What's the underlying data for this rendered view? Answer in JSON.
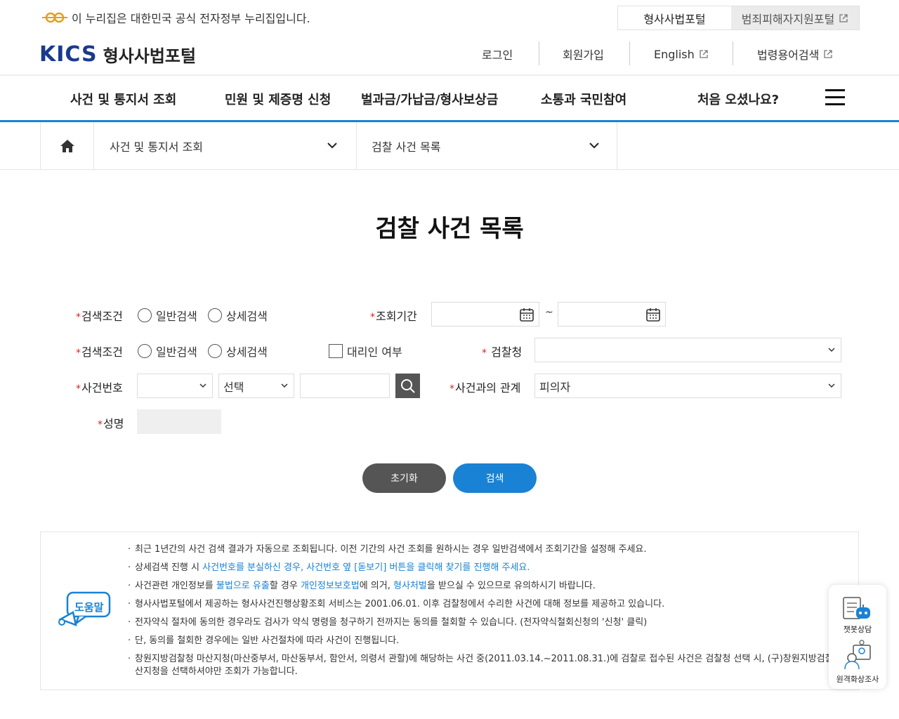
{
  "top": {
    "gov_notice": "이 누리집은 대한민국 공식 전자정부 누리집입니다.",
    "portal_tab_active": "형사사법포털",
    "portal_tab_other": "범죄피해자지원포털"
  },
  "header": {
    "logo_mark": "KICS",
    "logo_name": "형사사법포털",
    "login": "로그인",
    "signup": "회원가입",
    "english": "English",
    "law_search": "법령용어검색"
  },
  "gnb": {
    "items": [
      "사건 및 통지서 조회",
      "민원 및 제증명 신청",
      "벌과금/가납금/형사보상금",
      "소통과 국민참여",
      "처음 오셨나요?"
    ]
  },
  "breadcrumb": {
    "level1": "사건 및 통지서 조회",
    "level2": "검찰 사건 목록"
  },
  "page": {
    "title": "검찰 사건 목록"
  },
  "form": {
    "row1": {
      "label": "검색조건",
      "radio1": "일반검색",
      "radio2": "상세검색",
      "period_label": "조회기간",
      "tilde": "~"
    },
    "row2": {
      "label": "검색조건",
      "radio1": "일반검색",
      "radio2": "상세검색",
      "proxy_label": "대리인 여부",
      "office_label": "검찰청",
      "office_value": ""
    },
    "row3": {
      "label": "사건번호",
      "year_value": "",
      "type_value": "선택",
      "number_value": "",
      "relation_label": "사건과의 관계",
      "relation_value": "피의자"
    },
    "row4": {
      "label": "성명",
      "name_value": ""
    },
    "required_mark": "*",
    "reset_button": "초기화",
    "search_button": "검색"
  },
  "help": {
    "badge": "도움말",
    "items": [
      {
        "parts": [
          {
            "t": "최근 1년간의 사건 검색 결과가 자동으로 조회됩니다. 이전 기간의 사건 조회를 원하시는 경우 일반검색에서 조회기간을 설정해 주세요.",
            "c": ""
          }
        ]
      },
      {
        "parts": [
          {
            "t": "상세검색 진행 시 ",
            "c": ""
          },
          {
            "t": "사건번호를 분실하신 경우, 사건번호 옆 [돋보기] 버튼을 클릭해 찾기를 진행해 주세요.",
            "c": "blue"
          }
        ]
      },
      {
        "parts": [
          {
            "t": "사건관련 개인정보를 ",
            "c": ""
          },
          {
            "t": "불법으로 유출",
            "c": "blue"
          },
          {
            "t": "할 경우 ",
            "c": ""
          },
          {
            "t": "개인정보보호법",
            "c": "blue"
          },
          {
            "t": "에 의거, ",
            "c": ""
          },
          {
            "t": "형사처벌",
            "c": "blue"
          },
          {
            "t": "을 받으실 수 있으므로 유의하시기 바랍니다.",
            "c": ""
          }
        ]
      },
      {
        "parts": [
          {
            "t": "형사사법포털에서 제공하는 형사사건진행상황조회 서비스는 2001.06.01. 이후 검찰청에서 수리한 사건에 대해 정보를 제공하고 있습니다.",
            "c": ""
          }
        ]
      },
      {
        "parts": [
          {
            "t": "전자약식 절차에 동의한 경우라도 검사가 약식 명령을 청구하기 전까지는 동의를 철회할 수 있습니다. (전자약식철회신청의 '신청' 클릭)",
            "c": ""
          }
        ]
      },
      {
        "parts": [
          {
            "t": "단, 동의를 철회한 경우에는 일반 사건절차에 따라 사건이 진행됩니다.",
            "c": ""
          }
        ]
      },
      {
        "parts": [
          {
            "t": "창원지방검찰청 마산지청(마산중부서, 마산동부서, 함안서, 의령서 관할)에 해당하는 사건 중(2011.03.14.~2011.08.31.)에 검찰로 접수된 사건은 검찰청 선택 시, (구)창원지방검찰청 마산지청을 선택하셔야만 조회가 가능합니다.",
            "c": ""
          }
        ]
      }
    ]
  },
  "floating": {
    "chatbot": "챗봇상담",
    "video": "원격화상조사"
  }
}
